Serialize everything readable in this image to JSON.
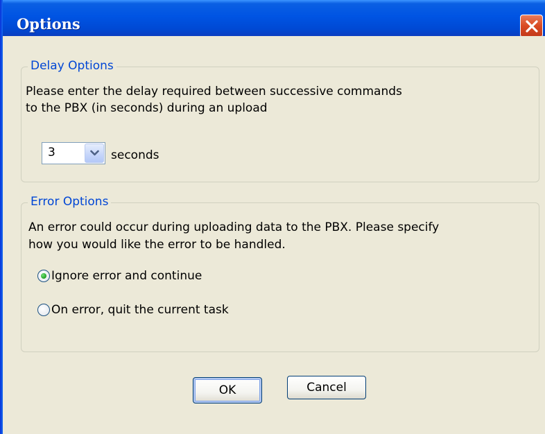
{
  "window": {
    "title": "Options",
    "close_icon": "close-icon"
  },
  "delay_options": {
    "legend": "Delay Options",
    "description_line1": "Please enter the delay required between successive commands",
    "description_line2": "to the PBX (in seconds) during an upload",
    "delay_value": "3",
    "unit_label": "seconds",
    "dropdown_icon": "chevron-down-icon"
  },
  "error_options": {
    "legend": "Error Options",
    "description_line1": "An error could occur during uploading data to the PBX. Please specify",
    "description_line2": "how you would like the error to be handled.",
    "options": [
      {
        "label": "Ignore error and continue",
        "selected": true
      },
      {
        "label": "On error, quit the current task",
        "selected": false
      }
    ]
  },
  "buttons": {
    "ok": "OK",
    "cancel": "Cancel"
  },
  "colors": {
    "titlebar": "#0054e3",
    "legend_text": "#0046d5",
    "dialog_bg": "#ece9d8",
    "close_button": "#d94a22",
    "radio_selected": "#21a121"
  }
}
